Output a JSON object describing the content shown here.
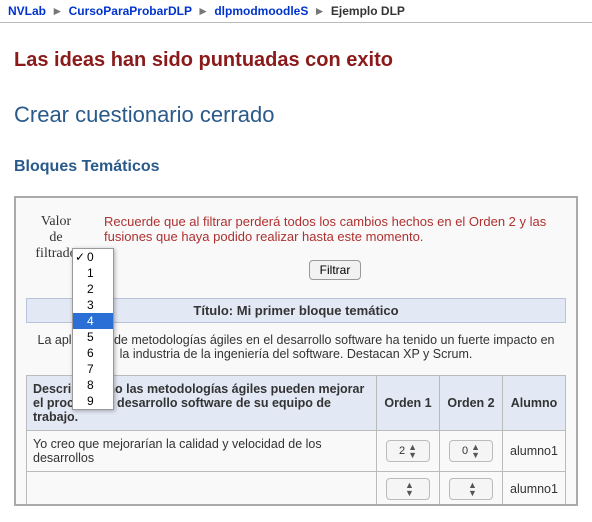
{
  "breadcrumb": {
    "items": [
      {
        "label": "NVLab"
      },
      {
        "label": "CursoParaProbarDLP"
      },
      {
        "label": "dlpmodmoodleS"
      },
      {
        "label": "Ejemplo DLP"
      }
    ]
  },
  "notice": "Las ideas han sido puntuadas con exito",
  "heading_crear": "Crear cuestionario cerrado",
  "heading_bloques": "Bloques Temáticos",
  "filter": {
    "label_line1": "Valor",
    "label_line2": "de",
    "label_line3": "filtrado",
    "warning": "Recuerde que al filtrar perderá todos los cambios hechos en el Orden 2 y las fusiones que haya podido realizar hasta este momento.",
    "button": "Filtrar",
    "dropdown": {
      "options": [
        "0",
        "1",
        "2",
        "3",
        "4",
        "5",
        "6",
        "7",
        "8",
        "9"
      ],
      "selected": "0",
      "highlighted": "4"
    }
  },
  "block": {
    "title_prefix": "Título: ",
    "title": "Mi primer bloque temático",
    "description": "La aplicación de metodologías ágiles en el desarrollo software ha tenido un fuerte impacto en la industria de la ingeniería del software. Destacan XP y Scrum.",
    "question_header": "Describa como las metodologías ágiles pueden mejorar el proceso de desarrollo software de su equipo de trabajo.",
    "col_orden1": "Orden 1",
    "col_orden2": "Orden 2",
    "col_alumno": "Alumno",
    "rows": [
      {
        "answer": "Yo creo que mejorarían la calidad y velocidad de los desarrollos",
        "orden1": "2",
        "orden2": "0",
        "alumno": "alumno1"
      },
      {
        "answer": "",
        "orden1": "",
        "orden2": "",
        "alumno": "alumno1"
      }
    ]
  }
}
